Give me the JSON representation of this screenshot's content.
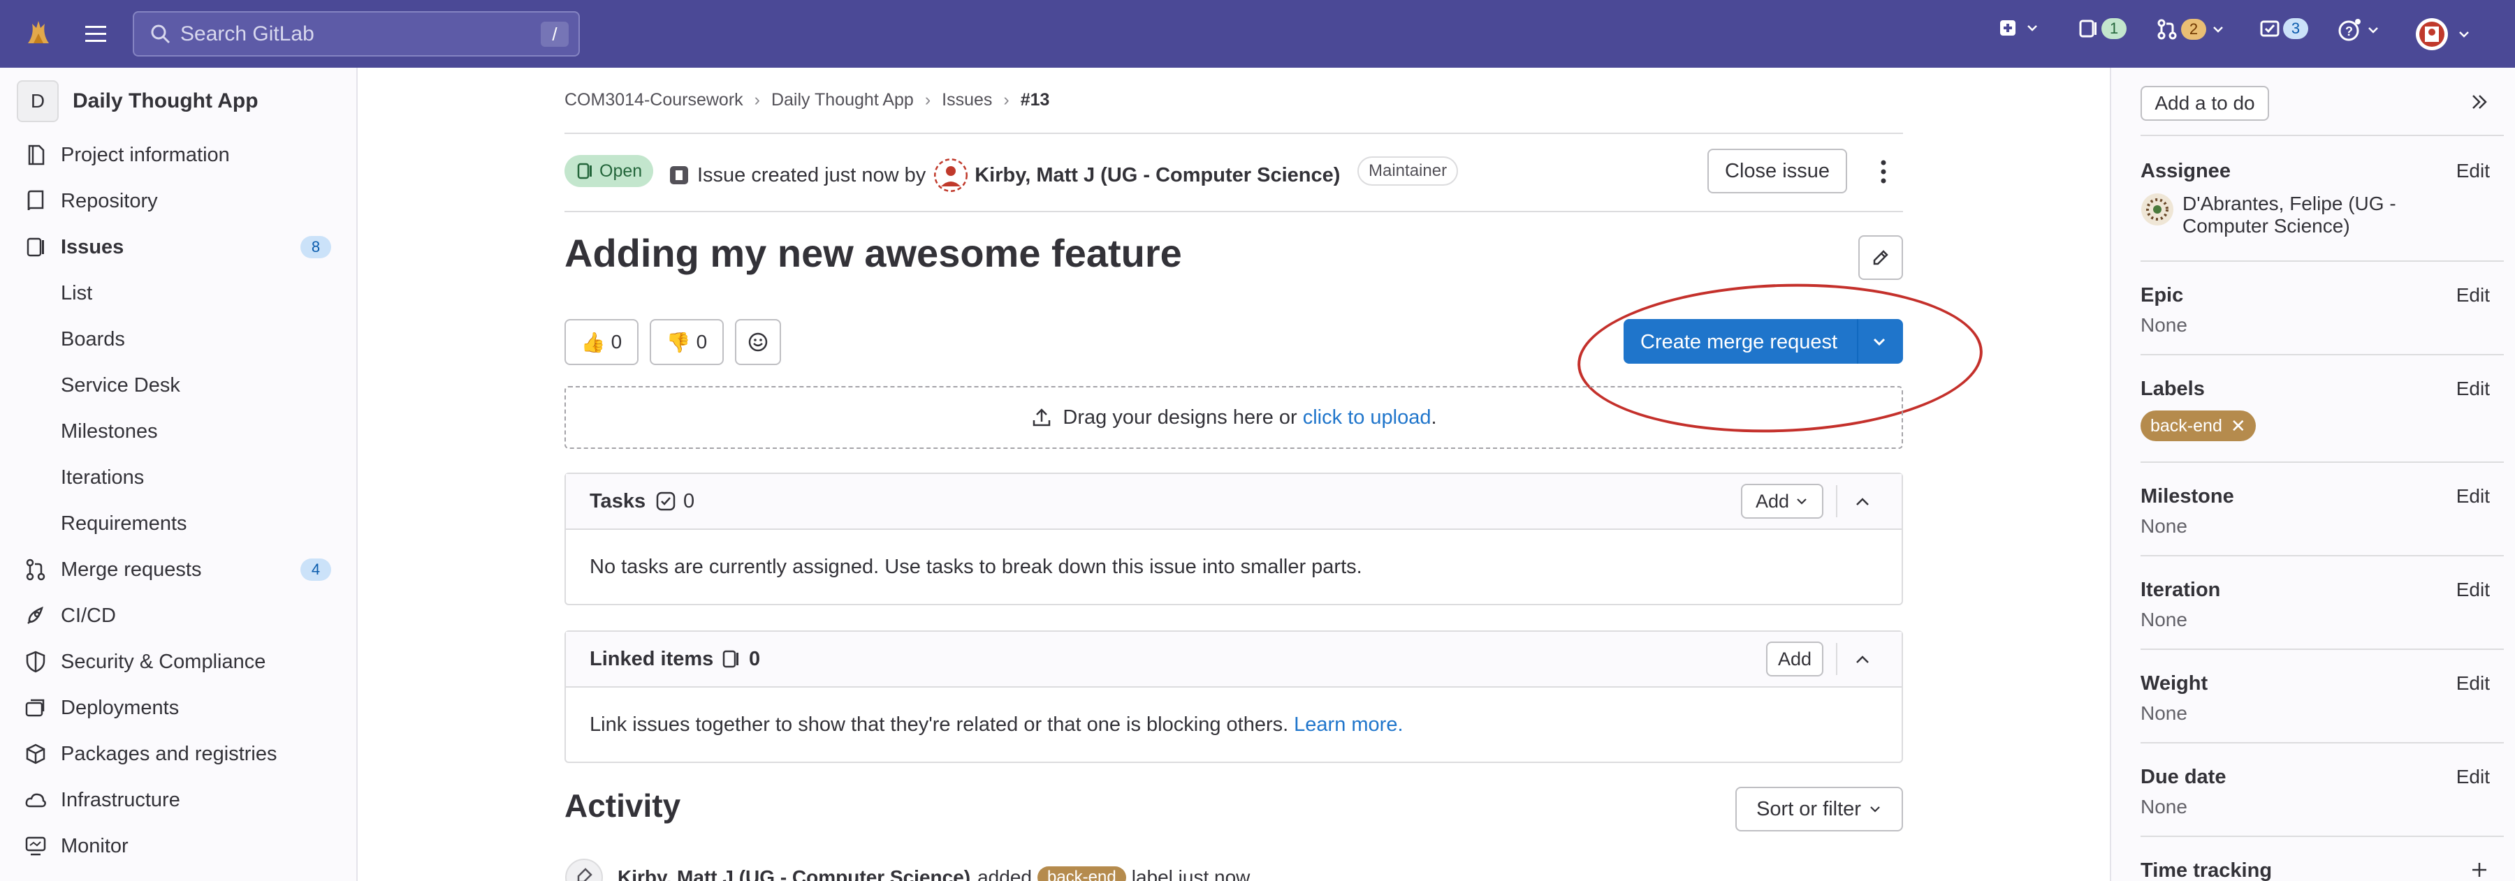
{
  "topbar": {
    "search_placeholder": "Search GitLab",
    "search_shortcut": "/",
    "issues_count": "1",
    "mr_count": "2",
    "todo_count": "3"
  },
  "sidebar": {
    "project_initial": "D",
    "project_name": "Daily Thought App",
    "items": [
      {
        "label": "Project information"
      },
      {
        "label": "Repository"
      },
      {
        "label": "Issues",
        "badge": "8"
      },
      {
        "label": "List"
      },
      {
        "label": "Boards"
      },
      {
        "label": "Service Desk"
      },
      {
        "label": "Milestones"
      },
      {
        "label": "Iterations"
      },
      {
        "label": "Requirements"
      },
      {
        "label": "Merge requests",
        "badge": "4"
      },
      {
        "label": "CI/CD"
      },
      {
        "label": "Security & Compliance"
      },
      {
        "label": "Deployments"
      },
      {
        "label": "Packages and registries"
      },
      {
        "label": "Infrastructure"
      },
      {
        "label": "Monitor"
      }
    ]
  },
  "breadcrumb": [
    "COM3014-Coursework",
    "Daily Thought App",
    "Issues",
    "#13"
  ],
  "issue": {
    "status": "Open",
    "created_prefix": "Issue created just now by",
    "author": "Kirby, Matt J (UG - Computer Science)",
    "role": "Maintainer",
    "close_label": "Close issue",
    "title": "Adding my new awesome feature",
    "thumbs_up": "0",
    "thumbs_down": "0",
    "create_mr_label": "Create merge request",
    "drop_text": "Drag your designs here or",
    "drop_link": "click to upload",
    "drop_suffix": "."
  },
  "tasks": {
    "title": "Tasks",
    "count": "0",
    "add_label": "Add",
    "empty": "No tasks are currently assigned. Use tasks to break down this issue into smaller parts."
  },
  "linked": {
    "title": "Linked items",
    "count": "0",
    "add_label": "Add",
    "text": "Link issues together to show that they're related or that one is blocking others.",
    "link": "Learn more."
  },
  "activity": {
    "title": "Activity",
    "sort_label": "Sort or filter",
    "row_author": "Kirby, Matt J (UG - Computer Science)",
    "row_action": "added",
    "row_label": "back-end",
    "row_suffix": "label just now"
  },
  "right_sidebar": {
    "todo_label": "Add a to do",
    "edit_label": "Edit",
    "assignee_title": "Assignee",
    "assignee_name": "D'Abrantes, Felipe (UG - Computer Science)",
    "epic_title": "Epic",
    "epic_value": "None",
    "labels_title": "Labels",
    "label_value": "back-end",
    "milestone_title": "Milestone",
    "milestone_value": "None",
    "iteration_title": "Iteration",
    "iteration_value": "None",
    "weight_title": "Weight",
    "weight_value": "None",
    "due_title": "Due date",
    "due_value": "None",
    "time_title": "Time tracking"
  },
  "colors": {
    "topbar": "#4b4996",
    "primary": "#1f75cb",
    "label": "#b58b4d",
    "open_status": "#c3e6cd",
    "annotation": "#c4302b"
  }
}
